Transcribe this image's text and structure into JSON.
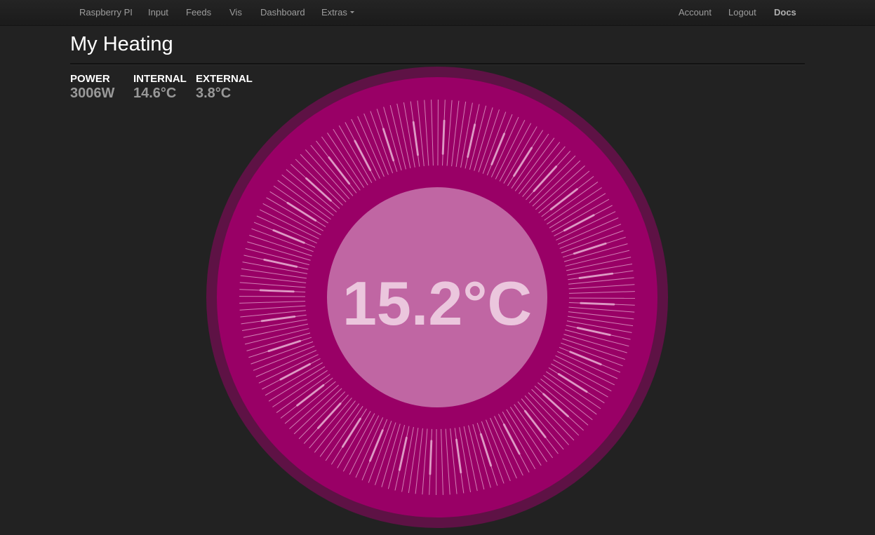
{
  "nav": {
    "left": [
      "Raspberry PI",
      "Input",
      "Feeds",
      "Vis",
      "Dashboard",
      "Extras"
    ],
    "right": [
      "Account",
      "Logout",
      "Docs"
    ]
  },
  "page": {
    "title": "My Heating"
  },
  "stats": [
    {
      "label": "POWER",
      "value": "3006W"
    },
    {
      "label": "INTERNAL",
      "value": "14.6°C"
    },
    {
      "label": "EXTERNAL",
      "value": "3.8°C"
    }
  ],
  "thermostat": {
    "temperature": "15.2°C",
    "colors": {
      "outer_ring": "#5e1245",
      "dial": "#990066",
      "center": "#c066a3",
      "text": "#ebc6dd",
      "ticks": "#e9b5d5"
    }
  }
}
